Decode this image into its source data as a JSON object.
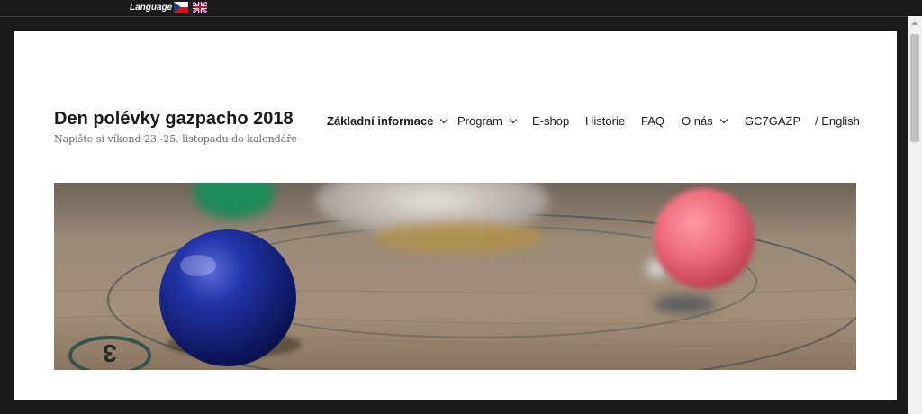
{
  "language_bar": {
    "label": "Language",
    "flags": [
      {
        "icon": "czech-flag-icon"
      },
      {
        "icon": "uk-flag-icon"
      }
    ]
  },
  "site": {
    "title": "Den polévky gazpacho 2018",
    "tagline": "Napište si víkend 23.-25. listopadu do kalendáře"
  },
  "nav": {
    "items": [
      {
        "label": "Základní informace",
        "dropdown": true,
        "active": true
      },
      {
        "label": "Program",
        "dropdown": true,
        "active": false
      },
      {
        "label": "E-shop",
        "dropdown": false,
        "active": false
      },
      {
        "label": "Historie",
        "dropdown": false,
        "active": false
      },
      {
        "label": "FAQ",
        "dropdown": false,
        "active": false
      },
      {
        "label": "O nás",
        "dropdown": true,
        "active": false
      },
      {
        "label": "GC7GAZP",
        "dropdown": false,
        "active": false
      },
      {
        "label": "/ English",
        "dropdown": false,
        "active": false
      }
    ]
  },
  "header_image": {
    "subject": "marbles on wooden board",
    "colors": {
      "wood": "#9c8a75",
      "blue_ball": "#1c2a8c",
      "pink_ball": "#e86a7a",
      "green_ball": "#1e8a5a"
    }
  },
  "colors": {
    "page_bg": "#1a1a1a",
    "content_bg": "#ffffff",
    "text": "#1a1a1a",
    "muted": "#686868"
  }
}
